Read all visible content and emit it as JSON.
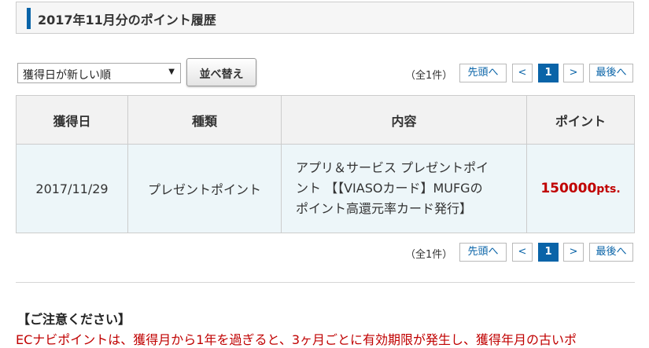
{
  "header": {
    "title": "2017年11月分のポイント履歴"
  },
  "sort": {
    "selected": "獲得日が新しい順",
    "button_label": "並べ替え"
  },
  "pager": {
    "total": "（全1件）",
    "first": "先頭へ",
    "prev": "<",
    "current": "1",
    "next": ">",
    "last": "最後へ"
  },
  "table": {
    "headers": [
      "獲得日",
      "種類",
      "内容",
      "ポイント"
    ],
    "rows": [
      {
        "date": "2017/11/29",
        "type": "プレゼントポイント",
        "content_lines": [
          "アプリ＆サービス プレゼントポイ",
          "ント 【【VIASOカード】MUFGの",
          "ポイント高還元率カード発行】"
        ],
        "points": "150000",
        "points_unit": "pts."
      }
    ]
  },
  "notice": {
    "heading": "【ご注意ください】",
    "text": "ECナビポイントは、獲得月から1年を過ぎると、3ヶ月ごとに有効期限が発生し、獲得年月の古いポ"
  },
  "colors": {
    "accent": "#0a64a8",
    "points": "#c00000",
    "row_bg": "#edf6f9",
    "header_bg": "#f2f2f2"
  }
}
